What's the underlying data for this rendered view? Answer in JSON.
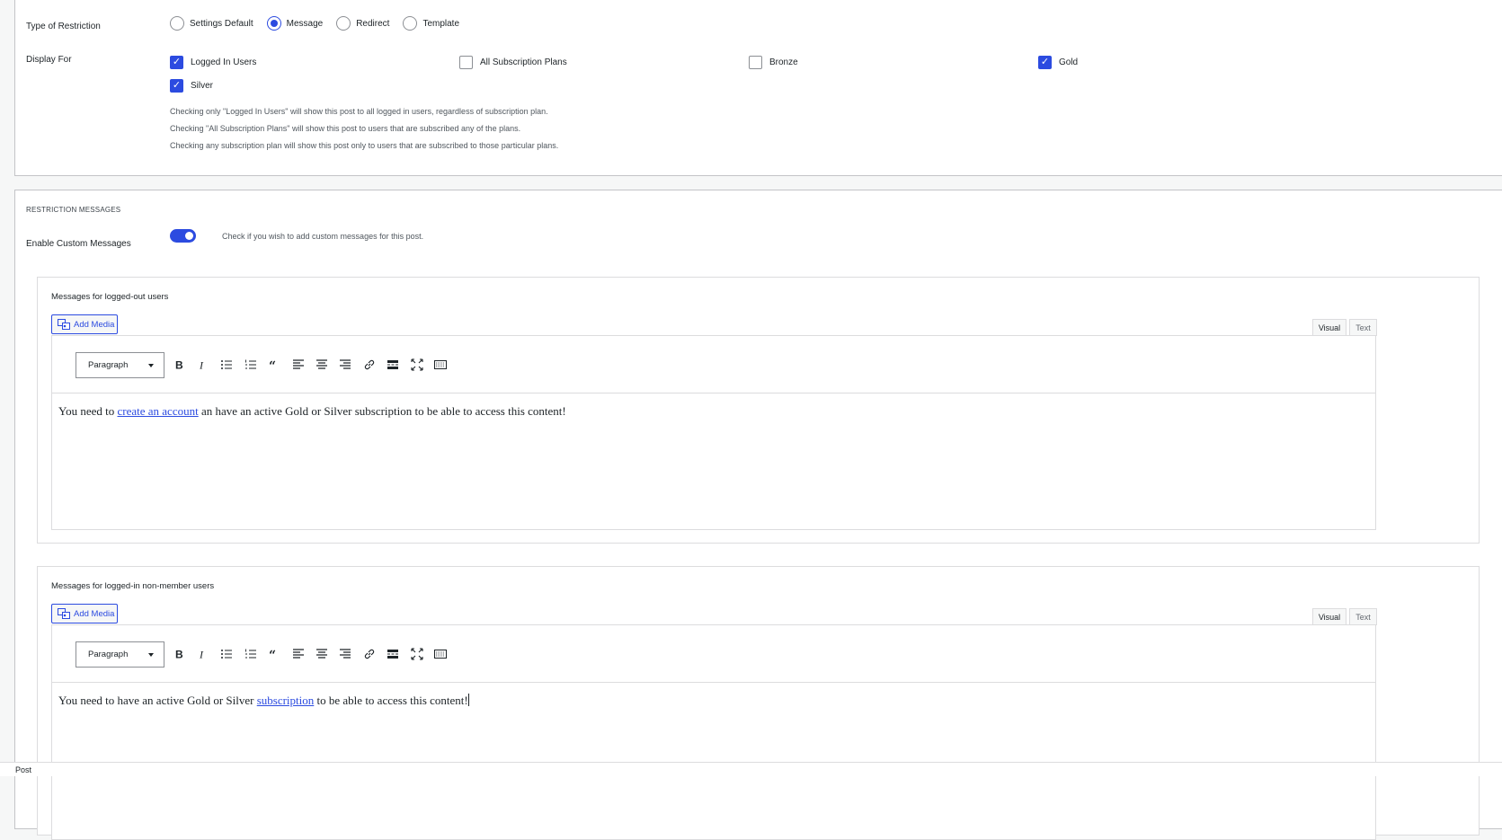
{
  "restriction": {
    "type_label": "Type of Restriction",
    "types": [
      {
        "label": "Settings Default",
        "checked": false
      },
      {
        "label": "Message",
        "checked": true
      },
      {
        "label": "Redirect",
        "checked": false
      },
      {
        "label": "Template",
        "checked": false
      }
    ],
    "display_for_label": "Display For",
    "display_options": [
      {
        "label": "Logged In Users",
        "checked": true
      },
      {
        "label": "All Subscription Plans",
        "checked": false
      },
      {
        "label": "Bronze",
        "checked": false
      },
      {
        "label": "Gold",
        "checked": true
      },
      {
        "label": "Silver",
        "checked": true
      }
    ],
    "help": [
      "Checking only \"Logged In Users\" will show this post to all logged in users, regardless of subscription plan.",
      "Checking \"All Subscription Plans\" will show this post to users that are subscribed any of the plans.",
      "Checking any subscription plan will show this post only to users that are subscribed to those particular plans."
    ]
  },
  "messages_section": {
    "title": "RESTRICTION MESSAGES",
    "enable_label": "Enable Custom Messages",
    "enable_on": true,
    "enable_help": "Check if you wish to add custom messages for this post."
  },
  "editors": [
    {
      "title": "Messages for logged-out users",
      "add_media": "Add Media",
      "tab_visual": "Visual",
      "tab_text": "Text",
      "format": "Paragraph",
      "text_before": "You need to ",
      "link_text": "create an account",
      "text_after": " an have an active Gold or Silver subscription to be able to access this content!"
    },
    {
      "title": "Messages for logged-in non-member users",
      "add_media": "Add Media",
      "tab_visual": "Visual",
      "tab_text": "Text",
      "format": "Paragraph",
      "text_before": "You need to have an active Gold or Silver ",
      "link_text": "subscription",
      "text_after": " to be able to access this content!"
    }
  ],
  "toolbar_icons": [
    "bold-icon",
    "italic-icon",
    "bullet-list-icon",
    "numbered-list-icon",
    "blockquote-icon",
    "align-left-icon",
    "align-center-icon",
    "align-right-icon",
    "link-icon",
    "read-more-icon",
    "fullscreen-icon",
    "toolbar-toggle-icon"
  ],
  "status_bar": {
    "text": "Post"
  },
  "colors": {
    "accent": "#2c4be0",
    "border": "#c3c4c7"
  }
}
